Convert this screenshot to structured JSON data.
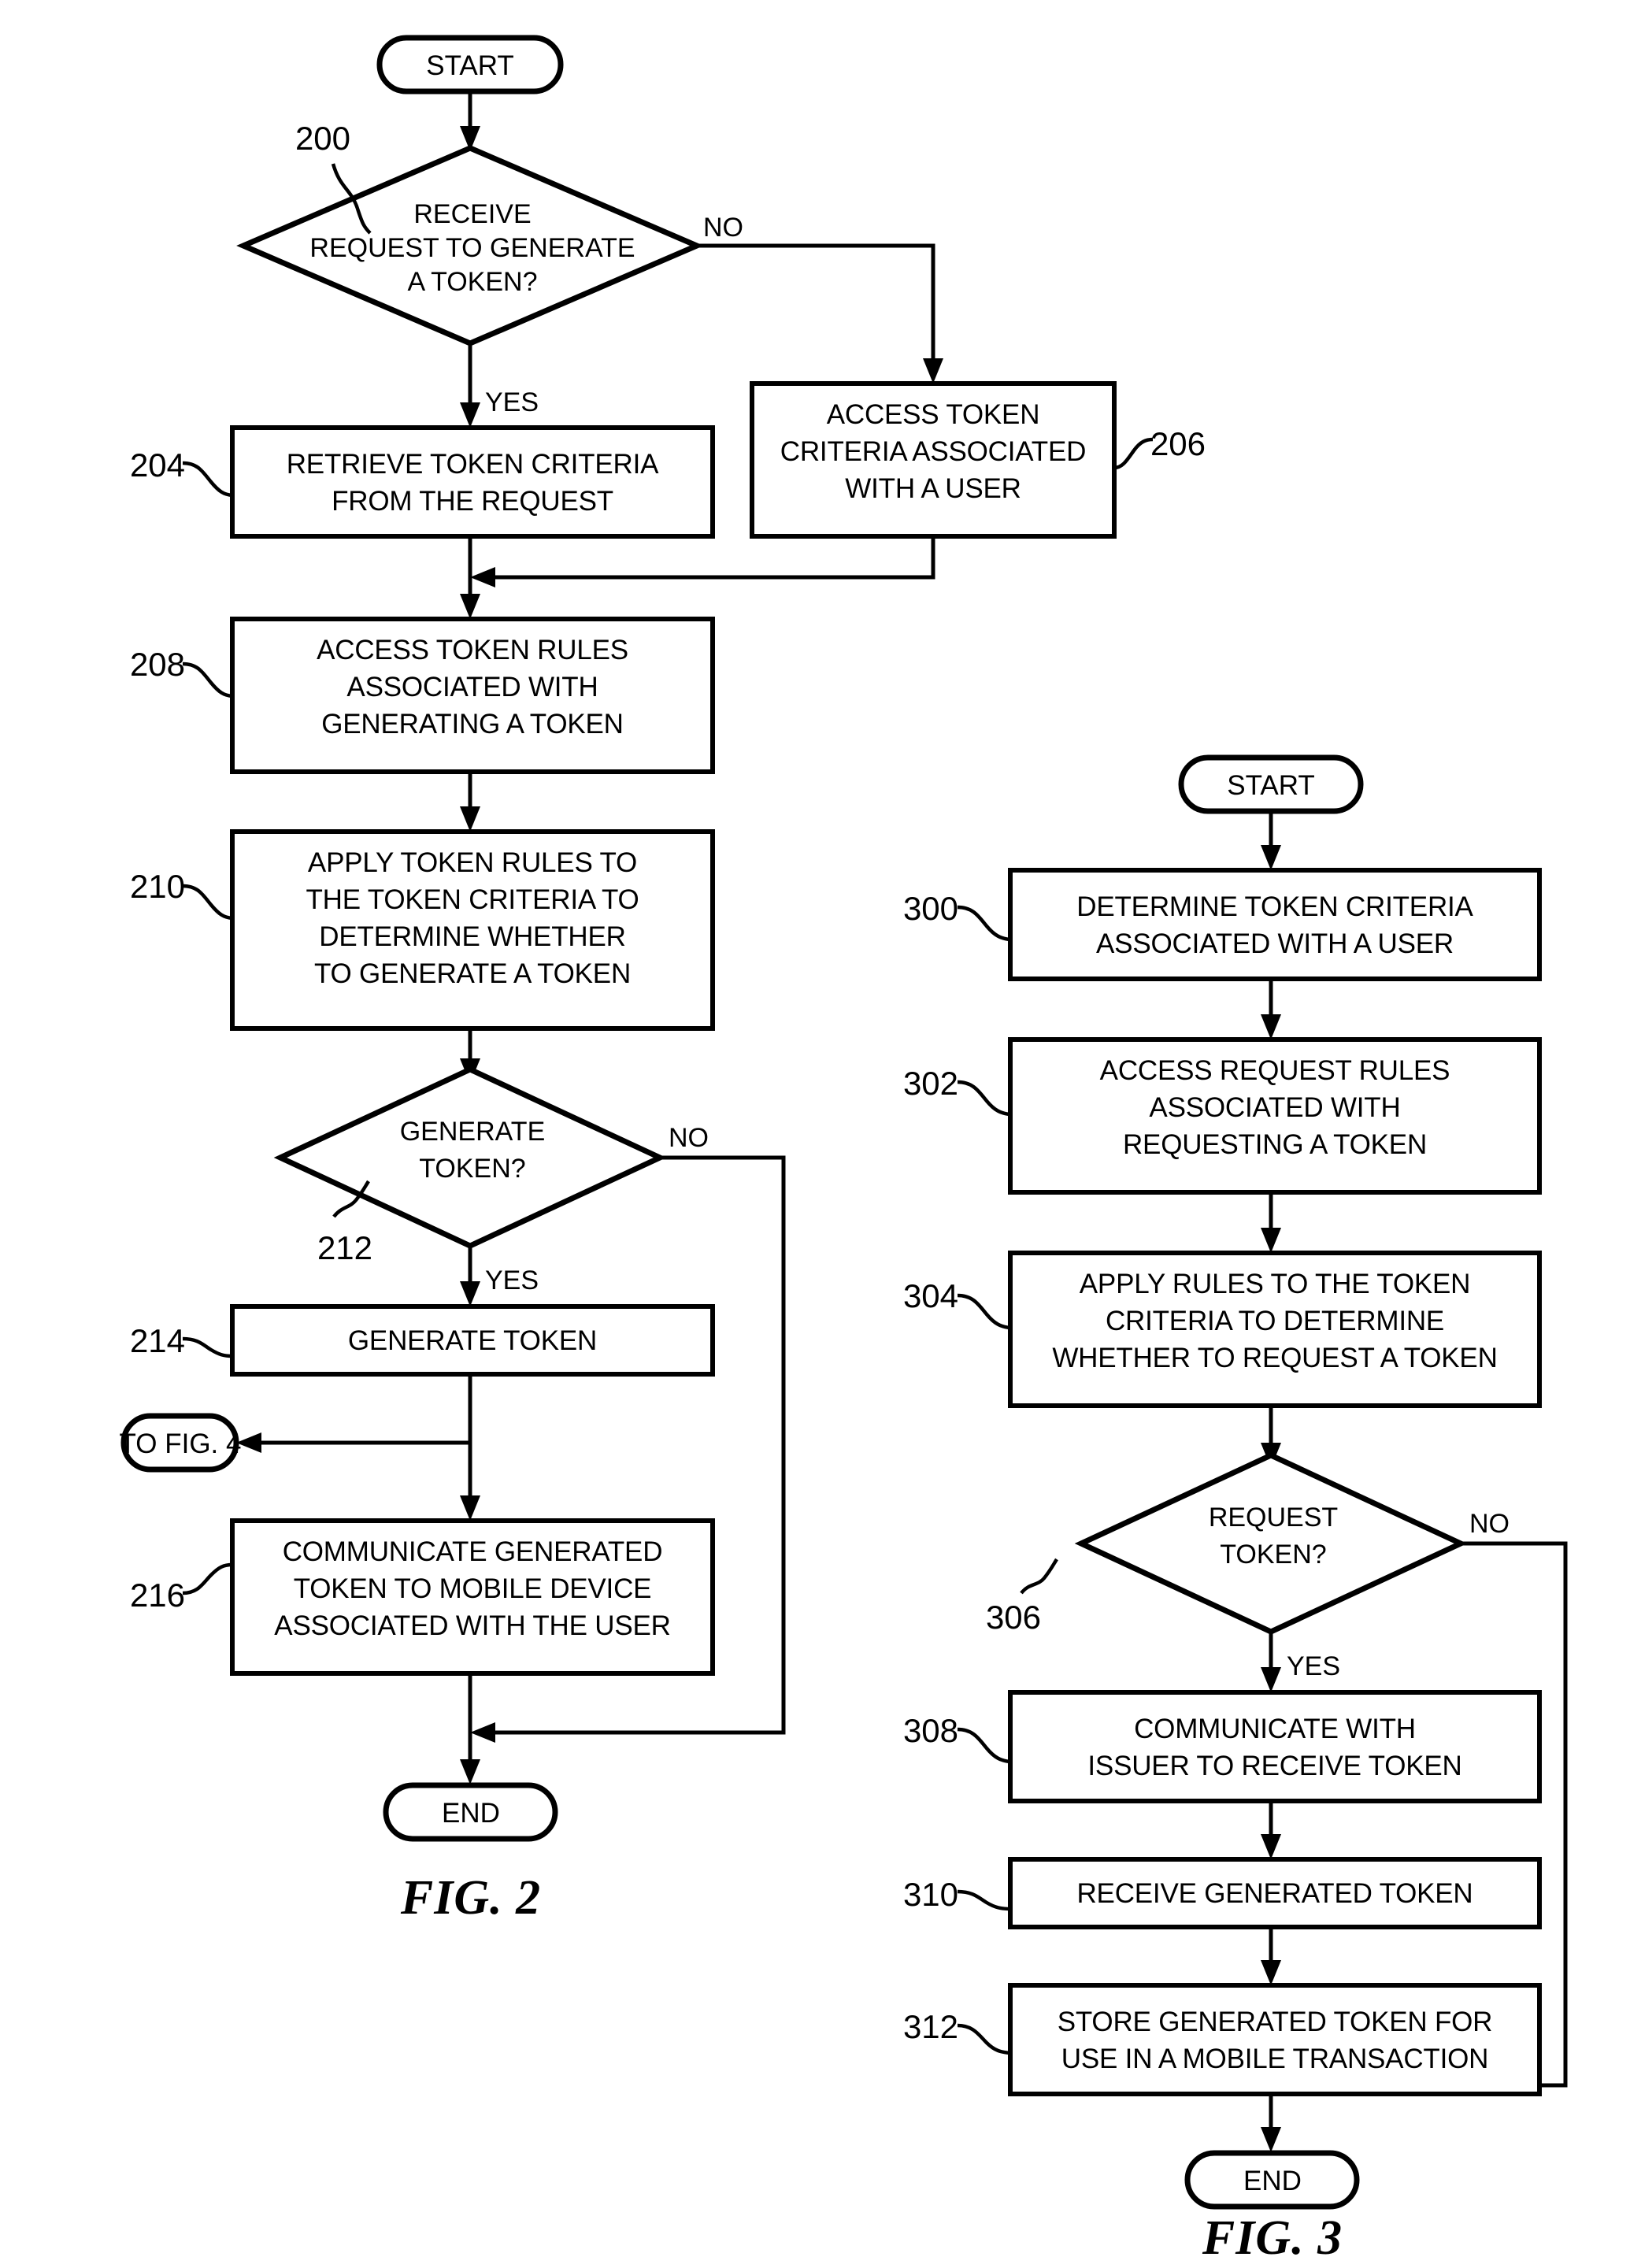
{
  "figures": [
    {
      "id": "fig2",
      "caption": "FIG. 2",
      "start_label": "START",
      "end_label": "END",
      "offpage_label": "TO FIG. 4",
      "yes_label": "YES",
      "no_label": "NO",
      "nodes": [
        {
          "ref": "200",
          "type": "decision",
          "text": [
            "RECEIVE",
            "REQUEST TO GENERATE",
            "A TOKEN?"
          ]
        },
        {
          "ref": "204",
          "type": "process",
          "text": [
            "RETRIEVE TOKEN CRITERIA",
            "FROM THE REQUEST"
          ]
        },
        {
          "ref": "206",
          "type": "process",
          "text": [
            "ACCESS TOKEN",
            "CRITERIA ASSOCIATED",
            "WITH A USER"
          ]
        },
        {
          "ref": "208",
          "type": "process",
          "text": [
            "ACCESS TOKEN RULES",
            "ASSOCIATED WITH",
            "GENERATING A TOKEN"
          ]
        },
        {
          "ref": "210",
          "type": "process",
          "text": [
            "APPLY TOKEN RULES TO",
            "THE TOKEN CRITERIA TO",
            "DETERMINE WHETHER",
            "TO GENERATE A TOKEN"
          ]
        },
        {
          "ref": "212",
          "type": "decision",
          "text": [
            "GENERATE",
            "TOKEN?"
          ]
        },
        {
          "ref": "214",
          "type": "process",
          "text": [
            "GENERATE TOKEN"
          ]
        },
        {
          "ref": "216",
          "type": "process",
          "text": [
            "COMMUNICATE GENERATED",
            "TOKEN TO MOBILE DEVICE",
            "ASSOCIATED WITH THE USER"
          ]
        }
      ]
    },
    {
      "id": "fig3",
      "caption": "FIG. 3",
      "start_label": "START",
      "end_label": "END",
      "yes_label": "YES",
      "no_label": "NO",
      "nodes": [
        {
          "ref": "300",
          "type": "process",
          "text": [
            "DETERMINE TOKEN CRITERIA",
            "ASSOCIATED WITH A USER"
          ]
        },
        {
          "ref": "302",
          "type": "process",
          "text": [
            "ACCESS REQUEST RULES",
            "ASSOCIATED WITH",
            "REQUESTING A TOKEN"
          ]
        },
        {
          "ref": "304",
          "type": "process",
          "text": [
            "APPLY RULES TO THE TOKEN",
            "CRITERIA TO DETERMINE",
            "WHETHER TO REQUEST A TOKEN"
          ]
        },
        {
          "ref": "306",
          "type": "decision",
          "text": [
            "REQUEST",
            "TOKEN?"
          ]
        },
        {
          "ref": "308",
          "type": "process",
          "text": [
            "COMMUNICATE WITH",
            "ISSUER TO RECEIVE TOKEN"
          ]
        },
        {
          "ref": "310",
          "type": "process",
          "text": [
            "RECEIVE GENERATED TOKEN"
          ]
        },
        {
          "ref": "312",
          "type": "process",
          "text": [
            "STORE GENERATED TOKEN FOR",
            "USE IN A MOBILE TRANSACTION"
          ]
        }
      ]
    }
  ],
  "fig2": {
    "start": "START",
    "end": "END",
    "offpage": "TO FIG. 4",
    "caption": "FIG. 2",
    "ref200": "200",
    "ref204": "204",
    "ref206": "206",
    "ref208": "208",
    "ref210": "210",
    "ref212": "212",
    "ref214": "214",
    "ref216": "216",
    "d200_l1": "RECEIVE",
    "d200_l2": "REQUEST TO GENERATE",
    "d200_l3": "A TOKEN?",
    "d200_no": "NO",
    "d200_yes": "YES",
    "b204_l1": "RETRIEVE TOKEN CRITERIA",
    "b204_l2": "FROM THE REQUEST",
    "b206_l1": "ACCESS TOKEN",
    "b206_l2": "CRITERIA ASSOCIATED",
    "b206_l3": "WITH A USER",
    "b208_l1": "ACCESS TOKEN RULES",
    "b208_l2": "ASSOCIATED WITH",
    "b208_l3": "GENERATING A TOKEN",
    "b210_l1": "APPLY TOKEN RULES TO",
    "b210_l2": "THE TOKEN CRITERIA TO",
    "b210_l3": "DETERMINE WHETHER",
    "b210_l4": "TO GENERATE A TOKEN",
    "d212_l1": "GENERATE",
    "d212_l2": "TOKEN?",
    "d212_no": "NO",
    "d212_yes": "YES",
    "b214_l1": "GENERATE TOKEN",
    "b216_l1": "COMMUNICATE GENERATED",
    "b216_l2": "TOKEN TO MOBILE DEVICE",
    "b216_l3": "ASSOCIATED WITH THE USER"
  },
  "fig3": {
    "start": "START",
    "end": "END",
    "caption": "FIG. 3",
    "ref300": "300",
    "ref302": "302",
    "ref304": "304",
    "ref306": "306",
    "ref308": "308",
    "ref310": "310",
    "ref312": "312",
    "b300_l1": "DETERMINE TOKEN CRITERIA",
    "b300_l2": "ASSOCIATED WITH A USER",
    "b302_l1": "ACCESS REQUEST RULES",
    "b302_l2": "ASSOCIATED WITH",
    "b302_l3": "REQUESTING A TOKEN",
    "b304_l1": "APPLY RULES TO THE TOKEN",
    "b304_l2": "CRITERIA TO DETERMINE",
    "b304_l3": "WHETHER TO REQUEST A TOKEN",
    "d306_l1": "REQUEST",
    "d306_l2": "TOKEN?",
    "d306_no": "NO",
    "d306_yes": "YES",
    "b308_l1": "COMMUNICATE WITH",
    "b308_l2": "ISSUER TO RECEIVE TOKEN",
    "b310_l1": "RECEIVE GENERATED TOKEN",
    "b312_l1": "STORE GENERATED TOKEN FOR",
    "b312_l2": "USE IN A MOBILE TRANSACTION"
  },
  "colors": {
    "ink": "#000000",
    "paper": "#ffffff"
  }
}
